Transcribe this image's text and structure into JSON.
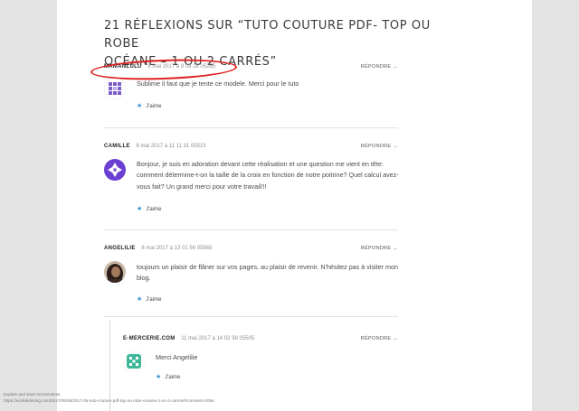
{
  "heading": {
    "line1": "21 RÉFLEXIONS SUR “TUTO COUTURE PDF- TOP OU ROBE",
    "line2": "OCÉANE – 1 OU 2 CARRÉS”"
  },
  "comments": [
    {
      "author": "MAMANLULU",
      "date": "8 mai 2017 à 9 09 28 05285",
      "reply": "RÉPONDRE →",
      "text": "Sublime il faut que je tente ce modele. Merci pour le tuto",
      "like": "J'aime",
      "avatar_color": "#7b5cc7",
      "avatar": "pixel-avatar-purple"
    },
    {
      "author": "CAMILLE",
      "date": "8 mai 2017 à 11 11 31 05515",
      "reply": "RÉPONDRE →",
      "text": "Bonjour, je suis en adoration devant cette réalisation et une question me vient en tête: comment détermine-t-on la taille de la croix en fonction de notre poitrine? Quel calcul avez-vous fait? Un grand merci pour votre travail!!!",
      "like": "J'aime",
      "avatar_color": "#6a3fd1",
      "avatar": "pixel-avatar-violet"
    },
    {
      "author": "ANGELILIE",
      "date": "8 mai 2017 à 13 01 56 05565",
      "reply": "RÉPONDRE →",
      "text": "toujours un plaisir de flâner sur vos pages, au plaisir de revenir. N'hésitez pas à visiter mon blog.",
      "like": "J'aime",
      "avatar": "photo-avatar"
    },
    {
      "author": "E-MERCERIE.COM",
      "date": "11 mai 2017 à 14 02 38 05505",
      "reply": "RÉPONDRE →",
      "text": "Merci Angelilie",
      "like": "J'aime",
      "avatar_color": "#3fb89a",
      "avatar": "pixel-avatar-teal"
    }
  ],
  "caption": {
    "line1": "Explain and Save Screenshots",
    "line2": "https://ecolahdesing.com/2017/05/08/2017-05-tuto-couture-pdf-top-ou-robe-oceane-1-ou-2-carres/#comment-2064"
  },
  "colors": {
    "annotation": "#e01f1f",
    "like_star": "#2e91d1",
    "page_bg": "#ffffff",
    "side_bg": "#e3e3e3"
  }
}
